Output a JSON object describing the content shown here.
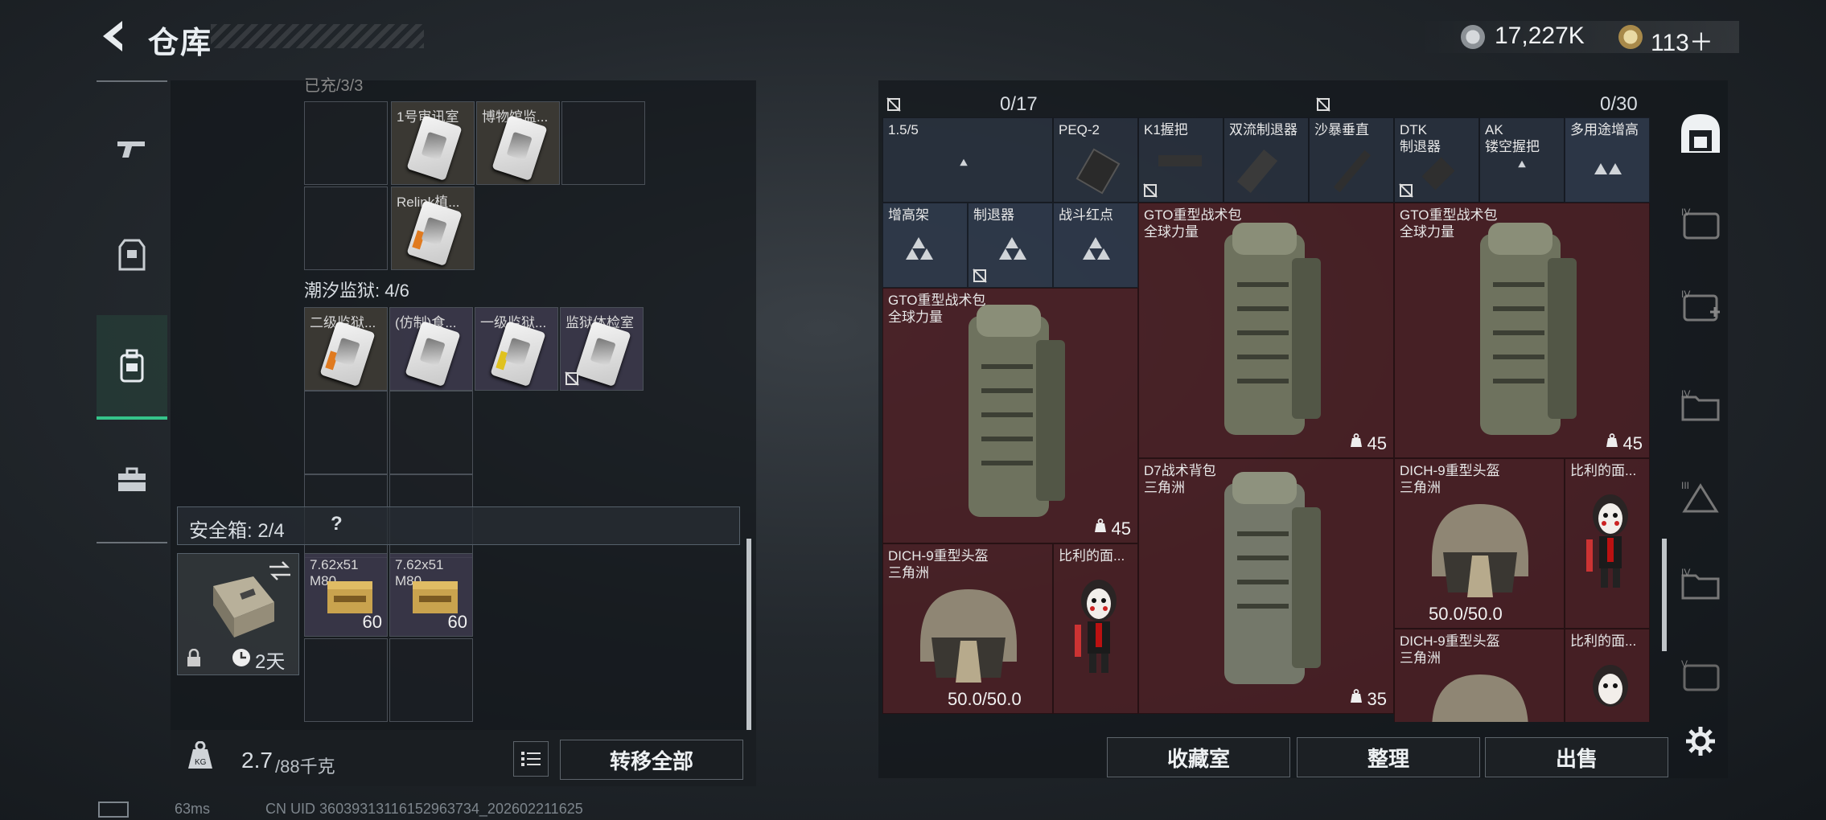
{
  "header": {
    "title": "仓库",
    "currency_1": "17,227K",
    "currency_2": "113＋"
  },
  "left_panel": {
    "top_cut_label": "已充/3/3",
    "top_grid": [
      {
        "label": "1号审讯室"
      },
      {
        "label": "博物馆监..."
      },
      {
        "label": "Relink植..."
      }
    ],
    "section_prison": "潮汐监狱: 4/6",
    "prison_items": [
      {
        "label": "二级监狱..."
      },
      {
        "label": "(仿制)食..."
      },
      {
        "label": "一级监狱..."
      },
      {
        "label": "监狱体检室"
      }
    ],
    "safebox": {
      "label": "安全箱: 2/4",
      "help": "?",
      "timer": "2天",
      "ammo": [
        {
          "name": "7.62x51",
          "sub": "M80",
          "count": "60"
        },
        {
          "name": "7.62x51",
          "sub": "M80",
          "count": "60"
        }
      ]
    },
    "footer": {
      "weight": "2.7",
      "weight_max": "/88千克",
      "transfer_all": "转移全部"
    }
  },
  "right_panel": {
    "top_counts": [
      "0/17",
      "0/30"
    ],
    "row1": [
      "1.5/5",
      "PEQ-2",
      "K1握把",
      "双流制退器",
      "沙暴垂直",
      "DTK\n制退器",
      "AK\n镂空握把",
      "多用途增高"
    ],
    "row2": [
      "增高架",
      "制退器",
      "战斗红点"
    ],
    "backpacks": [
      {
        "name": "GTO重型战术包\n全球力量",
        "count": "45"
      },
      {
        "name": "GTO重型战术包\n全球力量",
        "count": "45"
      },
      {
        "name": "GTO重型战术包\n全球力量",
        "count": "45"
      },
      {
        "name": "D7战术背包\n三角洲",
        "count": "35"
      }
    ],
    "helmets": [
      {
        "name": "DICH-9重型头盔\n三角洲",
        "durability": "50.0/50.0"
      },
      {
        "name": "DICH-9重型头盔\n三角洲",
        "durability": "50.0/50.0"
      },
      {
        "name": "DICH-9重型头盔\n三角洲",
        "durability": ""
      }
    ],
    "masks": [
      "比利的面...",
      "比利的面...",
      "比利的面..."
    ],
    "buttons": {
      "collection": "收藏室",
      "organize": "整理",
      "sell": "出售"
    }
  },
  "status_bar": {
    "ping": "63ms",
    "uid": "CN UID 3603931311615296373​4_202602211625"
  },
  "colors": {
    "accent_green": "#35c48a",
    "item_red": "#6e242a",
    "item_blue": "#344054"
  }
}
